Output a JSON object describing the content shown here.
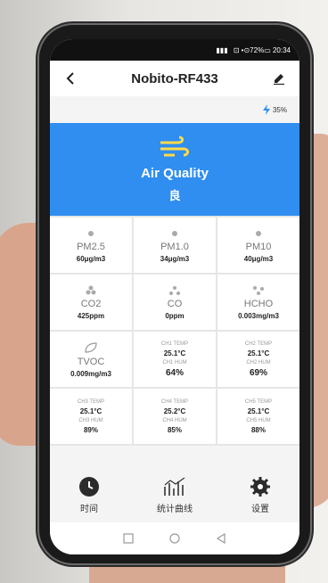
{
  "status_bar": {
    "text": "⊡ •⊙72%▭ 20:34"
  },
  "header": {
    "title": "Nobito-RF433"
  },
  "battery": {
    "percent": "35%"
  },
  "air_quality": {
    "label": "Air Quality",
    "value": "良"
  },
  "sensors": [
    {
      "name": "PM2.5",
      "value": "60μg/m3",
      "icon": "dust-icon"
    },
    {
      "name": "PM1.0",
      "value": "34μg/m3",
      "icon": "dust-icon"
    },
    {
      "name": "PM10",
      "value": "40μg/m3",
      "icon": "dust-icon"
    },
    {
      "name": "CO2",
      "value": "425ppm",
      "icon": "co2-icon"
    },
    {
      "name": "CO",
      "value": "0ppm",
      "icon": "co-icon"
    },
    {
      "name": "HCHO",
      "value": "0.003mg/m3",
      "icon": "hcho-icon"
    }
  ],
  "tvoc": {
    "name": "TVOC",
    "value": "0.009mg/m3"
  },
  "channels": [
    {
      "temp_label": "CH1 TEMP",
      "temp": "25.1°C",
      "hum_label": "CH1 HUM",
      "hum": "64%"
    },
    {
      "temp_label": "CH2 TEMP",
      "temp": "25.1°C",
      "hum_label": "CH2 HUM",
      "hum": "69%"
    },
    {
      "temp_label": "CH3 TEMP",
      "temp": "25.1°C",
      "hum_label": "CH3 HUM",
      "hum": "89%"
    },
    {
      "temp_label": "CH4 TEMP",
      "temp": "25.2°C",
      "hum_label": "CH4 HUM",
      "hum": "85%"
    },
    {
      "temp_label": "CH5 TEMP",
      "temp": "25.1°C",
      "hum_label": "CH5 HUM",
      "hum": "88%"
    }
  ],
  "tabs": [
    {
      "label": "时间",
      "icon": "clock-icon"
    },
    {
      "label": "统计曲线",
      "icon": "chart-icon"
    },
    {
      "label": "设置",
      "icon": "gear-icon"
    }
  ],
  "colors": {
    "banner": "#2f8ef0",
    "accent": "#2f8ef0"
  }
}
